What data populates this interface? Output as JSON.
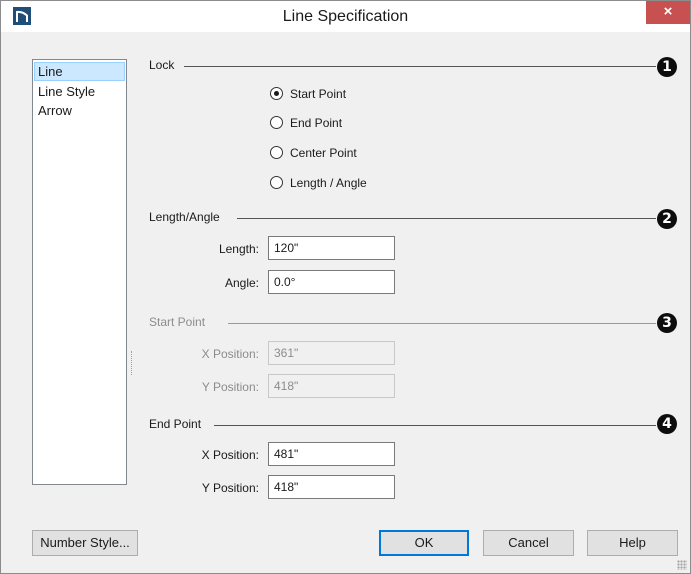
{
  "window": {
    "title": "Line Specification",
    "close_glyph": "×",
    "icon": "app-logo-icon"
  },
  "sidebar": {
    "items": [
      {
        "label": "Line",
        "selected": true
      },
      {
        "label": "Line Style",
        "selected": false
      },
      {
        "label": "Arrow",
        "selected": false
      }
    ]
  },
  "lock": {
    "label": "Lock",
    "callout": "1",
    "options": [
      {
        "label": "Start Point",
        "checked": true
      },
      {
        "label": "End Point",
        "checked": false
      },
      {
        "label": "Center Point",
        "checked": false
      },
      {
        "label": "Length / Angle",
        "checked": false
      }
    ]
  },
  "length_angle": {
    "label": "Length/Angle",
    "callout": "2",
    "length_label": "Length:",
    "length_value": "120\"",
    "angle_label": "Angle:",
    "angle_value": "0.0°"
  },
  "start_point": {
    "label": "Start Point",
    "callout": "3",
    "disabled": true,
    "x_label": "X Position:",
    "x_value": "361\"",
    "y_label": "Y Position:",
    "y_value": "418\""
  },
  "end_point": {
    "label": "End Point",
    "callout": "4",
    "x_label": "X Position:",
    "x_value": "481\"",
    "y_label": "Y Position:",
    "y_value": "418\""
  },
  "buttons": {
    "number_style": "Number Style...",
    "ok": "OK",
    "cancel": "Cancel",
    "help": "Help"
  },
  "colors": {
    "close_bg": "#c75050",
    "selection_bg": "#cce8ff",
    "default_button_border": "#0078d7"
  }
}
